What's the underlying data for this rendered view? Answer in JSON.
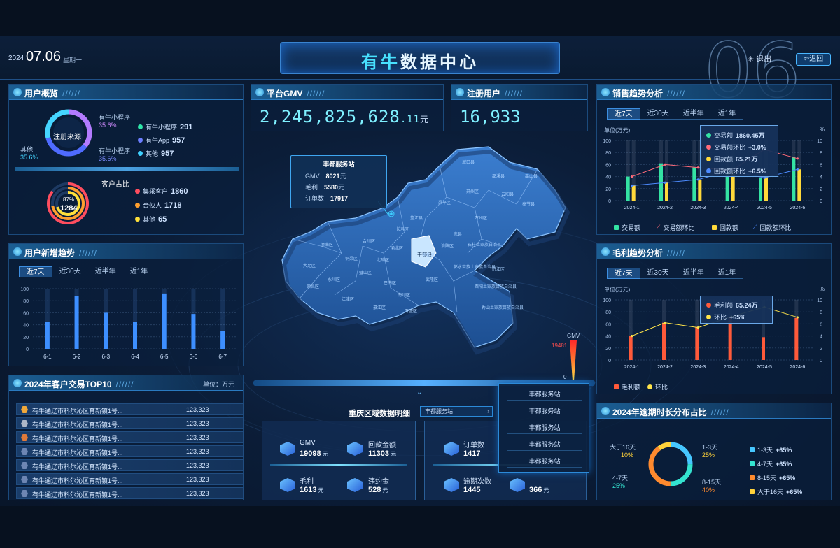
{
  "header": {
    "title_a": "有牛",
    "title_b": "数据中心",
    "year": "2024",
    "date": "07.06",
    "weekday": "星期一",
    "big_num": "06",
    "logout": "退出",
    "back": "返回"
  },
  "user_overview": {
    "title": "用户概览",
    "center": "注册来源",
    "callouts": [
      {
        "name": "有牛小程序",
        "pct": "35.6%"
      },
      {
        "name": "有牛小程序",
        "pct": "35.6%"
      },
      {
        "name": "其他",
        "pct": "35.6%"
      }
    ],
    "legend": [
      {
        "label": "有牛小程序",
        "value": "291",
        "color": "#2ee6a8"
      },
      {
        "label": "有牛App",
        "value": "957",
        "color": "#6b7dff"
      },
      {
        "label": "其他",
        "value": "957",
        "color": "#3fd0ff"
      }
    ],
    "ratio_title": "客户占比",
    "ratio_pct": "87%",
    "ratio_num": "1284",
    "ratio_legend": [
      {
        "label": "集采客户",
        "value": "1860",
        "color": "#ff4d5e"
      },
      {
        "label": "合伙人",
        "value": "1718",
        "color": "#ff9f2e"
      },
      {
        "label": "其他",
        "value": "65",
        "color": "#ffe03a"
      }
    ]
  },
  "gmv": {
    "title": "平台GMV",
    "int": "2,245,825,628",
    "dec": ".11",
    "unit": "元"
  },
  "reg": {
    "title": "注册用户",
    "value": "16,933"
  },
  "new_users": {
    "title": "用户新增趋势",
    "tabs": [
      "近7天",
      "近30天",
      "近半年",
      "近1年"
    ]
  },
  "top10": {
    "title": "2024年客户交易TOP10",
    "unit": "单位：万元",
    "rows": [
      {
        "name": "有牛通辽市科尔沁区育新镇1号...",
        "value": "123,323",
        "color": "#f0a83a"
      },
      {
        "name": "有牛通辽市科尔沁区育新镇1号...",
        "value": "123,323",
        "color": "#aeb8c8"
      },
      {
        "name": "有牛通辽市科尔沁区育新镇1号...",
        "value": "123,323",
        "color": "#e07a3a"
      },
      {
        "name": "有牛通辽市科尔沁区育新镇1号...",
        "value": "123,323",
        "color": "#6e86b3"
      },
      {
        "name": "有牛通辽市科尔沁区育新镇1号...",
        "value": "123,323",
        "color": "#6e86b3"
      },
      {
        "name": "有牛通辽市科尔沁区育新镇1号...",
        "value": "123,323",
        "color": "#6e86b3"
      },
      {
        "name": "有牛通辽市科尔沁区育新镇1号...",
        "value": "123,323",
        "color": "#6e86b3"
      }
    ]
  },
  "map": {
    "tooltip_title": "丰都服务站",
    "gmv_label": "GMV",
    "gmv": "8021",
    "profit_label": "毛利",
    "profit": "5580",
    "orders_label": "订单数",
    "orders": "17917",
    "yuan": "元",
    "scale_label": "GMV",
    "scale_max": "19481",
    "scale_min": "0",
    "selected": "丰都县",
    "districts": [
      "城口县",
      "巫溪县",
      "巫山县",
      "开州区",
      "云阳县",
      "奉节县",
      "万州区",
      "梁平区",
      "忠县",
      "垫江县",
      "长寿区",
      "涪陵区",
      "丰都县",
      "石柱土家族自治县",
      "武隆区",
      "彭水苗族土家族自治县",
      "黔江区",
      "酉阳土家族苗族自治县",
      "秀山土家族苗族自治县",
      "南川区",
      "綦江区",
      "江津区",
      "永川区",
      "荣昌区",
      "大足区",
      "潼南区",
      "铜梁区",
      "合川区",
      "璧山区",
      "北碚区",
      "渝北区",
      "巴南区",
      "万盛区"
    ]
  },
  "detail": {
    "title": "重庆区域数据明细",
    "select": "丰都服务站",
    "items": [
      {
        "label": "GMV",
        "value": "19098",
        "unit": "元"
      },
      {
        "label": "回款金额",
        "value": "11303",
        "unit": "元"
      },
      {
        "label": "订单数",
        "value": "1417",
        "unit": ""
      },
      {
        "label": "毛利",
        "value": "1613",
        "unit": "元"
      },
      {
        "label": "违约金",
        "value": "528",
        "unit": "元"
      },
      {
        "label": "逾期次数",
        "value": "1445",
        "unit": ""
      },
      {
        "label": "",
        "value": "366",
        "unit": "元"
      }
    ],
    "dropdown": [
      "丰都服务站",
      "丰都服务站",
      "丰都服务站",
      "丰都服务站",
      "丰都服务站"
    ]
  },
  "sales": {
    "title": "销售趋势分析",
    "tabs": [
      "近7天",
      "近30天",
      "近半年",
      "近1年"
    ],
    "unit_left": "单位(万元)",
    "unit_right": "%",
    "tooltip": [
      {
        "label": "交易额",
        "value": "1860.45万"
      },
      {
        "label": "交易额环比",
        "value": "+3.0%"
      },
      {
        "label": "回款额",
        "value": "65.21万"
      },
      {
        "label": "回款额环比",
        "value": "+6.5%"
      }
    ],
    "legend": [
      "交易额",
      "交易额环比",
      "回款额",
      "回款额环比"
    ]
  },
  "margin": {
    "title": "毛利趋势分析",
    "tabs": [
      "近7天",
      "近30天",
      "近半年",
      "近1年"
    ],
    "unit_left": "单位(万元)",
    "unit_right": "%",
    "tooltip": [
      {
        "label": "毛利额",
        "value": "65.24万"
      },
      {
        "label": "环比",
        "value": "+65%"
      }
    ],
    "legend": [
      "毛利额",
      "环比"
    ]
  },
  "overdue": {
    "title": "2024年逾期时长分布占比",
    "callouts": [
      {
        "label": "大于16天",
        "pct": "10%"
      },
      {
        "label": "1-3天",
        "pct": "25%"
      },
      {
        "label": "4-7天",
        "pct": "25%"
      },
      {
        "label": "8-15天",
        "pct": "40%"
      }
    ],
    "legend": [
      {
        "label": "1-3天",
        "value": "+65%",
        "color": "#46c7ff"
      },
      {
        "label": "4-7天",
        "value": "+65%",
        "color": "#34e3d0"
      },
      {
        "label": "8-15天",
        "value": "+65%",
        "color": "#ff8a2e"
      },
      {
        "label": "大于16天",
        "value": "+65%",
        "color": "#ffd23a"
      }
    ]
  },
  "chart_data": [
    {
      "type": "bar",
      "title": "用户新增趋势",
      "categories": [
        "6-1",
        "6-2",
        "6-3",
        "6-4",
        "6-5",
        "6-6",
        "6-7"
      ],
      "values": [
        45,
        88,
        60,
        45,
        92,
        58,
        30
      ],
      "ylim": [
        0,
        100
      ],
      "yticks": [
        0,
        20,
        40,
        60,
        80,
        100
      ]
    },
    {
      "type": "bar",
      "title": "销售趋势分析",
      "categories": [
        "2024-1",
        "2024-2",
        "2024-3",
        "2024-4",
        "2024-5",
        "2024-6"
      ],
      "ylim": [
        0,
        100
      ],
      "y2lim": [
        0,
        10
      ],
      "yticks": [
        0,
        20,
        40,
        60,
        80,
        100
      ],
      "y2ticks": [
        0,
        2,
        4,
        6,
        8,
        10
      ],
      "series": [
        {
          "name": "交易额",
          "values": [
            40,
            62,
            55,
            48,
            38,
            72
          ],
          "color": "#34e3a3"
        },
        {
          "name": "回款额",
          "values": [
            25,
            30,
            35,
            50,
            40,
            52
          ],
          "color": "#ffd93a"
        },
        {
          "name": "交易额环比",
          "values": [
            4.0,
            6.0,
            5.5,
            5.0,
            8.5,
            7.0
          ],
          "color": "#ff6b7a",
          "kind": "line"
        },
        {
          "name": "回款额环比",
          "values": [
            2.5,
            3.0,
            3.5,
            5.0,
            3.8,
            5.2
          ],
          "color": "#4d8bff",
          "kind": "line"
        }
      ]
    },
    {
      "type": "bar",
      "title": "毛利趋势分析",
      "categories": [
        "2024-1",
        "2024-2",
        "2024-3",
        "2024-4",
        "2024-5",
        "2024-6"
      ],
      "ylim": [
        0,
        100
      ],
      "y2lim": [
        0,
        10
      ],
      "yticks": [
        0,
        20,
        40,
        60,
        80,
        100
      ],
      "y2ticks": [
        0,
        2,
        4,
        6,
        8,
        10
      ],
      "series": [
        {
          "name": "毛利额",
          "values": [
            40,
            62,
            55,
            72,
            38,
            70
          ],
          "color": "#ff5a3a"
        },
        {
          "name": "环比",
          "values": [
            4.0,
            6.2,
            5.4,
            7.2,
            8.8,
            7.1
          ],
          "color": "#ffe44a",
          "kind": "line"
        }
      ]
    }
  ]
}
